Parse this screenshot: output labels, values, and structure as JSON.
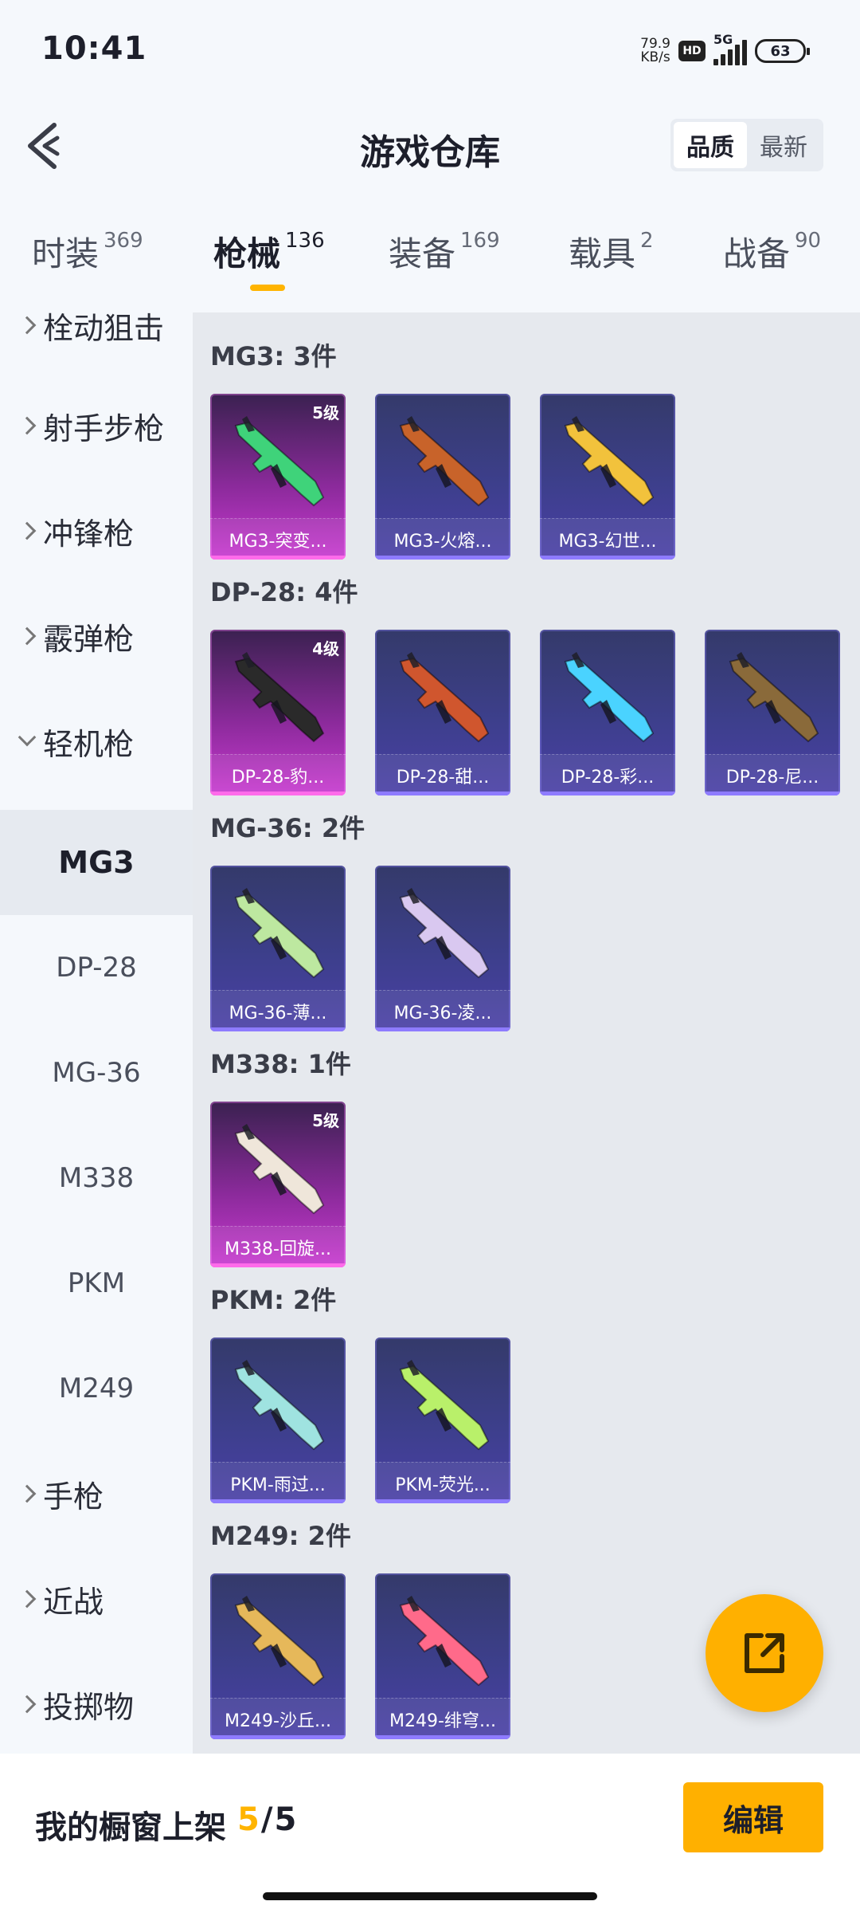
{
  "status": {
    "time": "10:41",
    "speed_value": "79.9",
    "speed_unit": "KB/s",
    "hd": "HD",
    "network": "5G",
    "battery": "63"
  },
  "header": {
    "title": "游戏仓库",
    "sort_quality": "品质",
    "sort_latest": "最新"
  },
  "tabs": [
    {
      "label": "时装",
      "count": "369"
    },
    {
      "label": "枪械",
      "count": "136"
    },
    {
      "label": "装备",
      "count": "169"
    },
    {
      "label": "载具",
      "count": "2"
    },
    {
      "label": "战备",
      "count": "90"
    }
  ],
  "sidebar": {
    "categories": [
      {
        "label": "栓动狙击"
      },
      {
        "label": "射手步枪"
      },
      {
        "label": "冲锋枪"
      },
      {
        "label": "霰弹枪"
      },
      {
        "label": "轻机枪"
      },
      {
        "label": "手枪"
      },
      {
        "label": "近战"
      },
      {
        "label": "投掷物"
      }
    ],
    "subitems": [
      "MG3",
      "DP-28",
      "MG-36",
      "M338",
      "PKM",
      "M249"
    ]
  },
  "groups": [
    {
      "title": "MG3: 3件",
      "items": [
        {
          "name": "MG3-突变...",
          "level": "5级",
          "accent": "#3fd37a"
        },
        {
          "name": "MG3-火熔...",
          "level": "",
          "accent": "#c8632a"
        },
        {
          "name": "MG3-幻世...",
          "level": "",
          "accent": "#f2c23c"
        }
      ]
    },
    {
      "title": "DP-28: 4件",
      "items": [
        {
          "name": "DP-28-豹...",
          "level": "4级",
          "accent": "#2a2a2a"
        },
        {
          "name": "DP-28-甜...",
          "level": "",
          "accent": "#d0562e"
        },
        {
          "name": "DP-28-彩...",
          "level": "",
          "accent": "#4ad3ff"
        },
        {
          "name": "DP-28-尼...",
          "level": "",
          "accent": "#8a6a3a"
        }
      ]
    },
    {
      "title": "MG-36: 2件",
      "items": [
        {
          "name": "MG-36-薄...",
          "level": "",
          "accent": "#bde8a0"
        },
        {
          "name": "MG-36-凌...",
          "level": "",
          "accent": "#d9c8f0"
        }
      ]
    },
    {
      "title": "M338: 1件",
      "items": [
        {
          "name": "M338-回旋...",
          "level": "5级",
          "accent": "#efe6da"
        }
      ]
    },
    {
      "title": "PKM: 2件",
      "items": [
        {
          "name": "PKM-雨过...",
          "level": "",
          "accent": "#9fe3e0"
        },
        {
          "name": "PKM-荧光...",
          "level": "",
          "accent": "#b9f06a"
        }
      ]
    },
    {
      "title": "M249: 2件",
      "items": [
        {
          "name": "M249-沙丘...",
          "level": "",
          "accent": "#e6b85a"
        },
        {
          "name": "M249-绯穹...",
          "level": "",
          "accent": "#ff6a8a"
        }
      ]
    }
  ],
  "bottom": {
    "showcase_label": "我的橱窗上架",
    "showcase_used": "5",
    "showcase_total": "5",
    "edit_label": "编辑"
  },
  "colors": {
    "accent": "#ffb000",
    "blue_card": "#3d3f8c",
    "purple_card": "#c83ad0"
  },
  "icons": {
    "back": "back-arrow-icon",
    "fab": "share-external-icon"
  }
}
